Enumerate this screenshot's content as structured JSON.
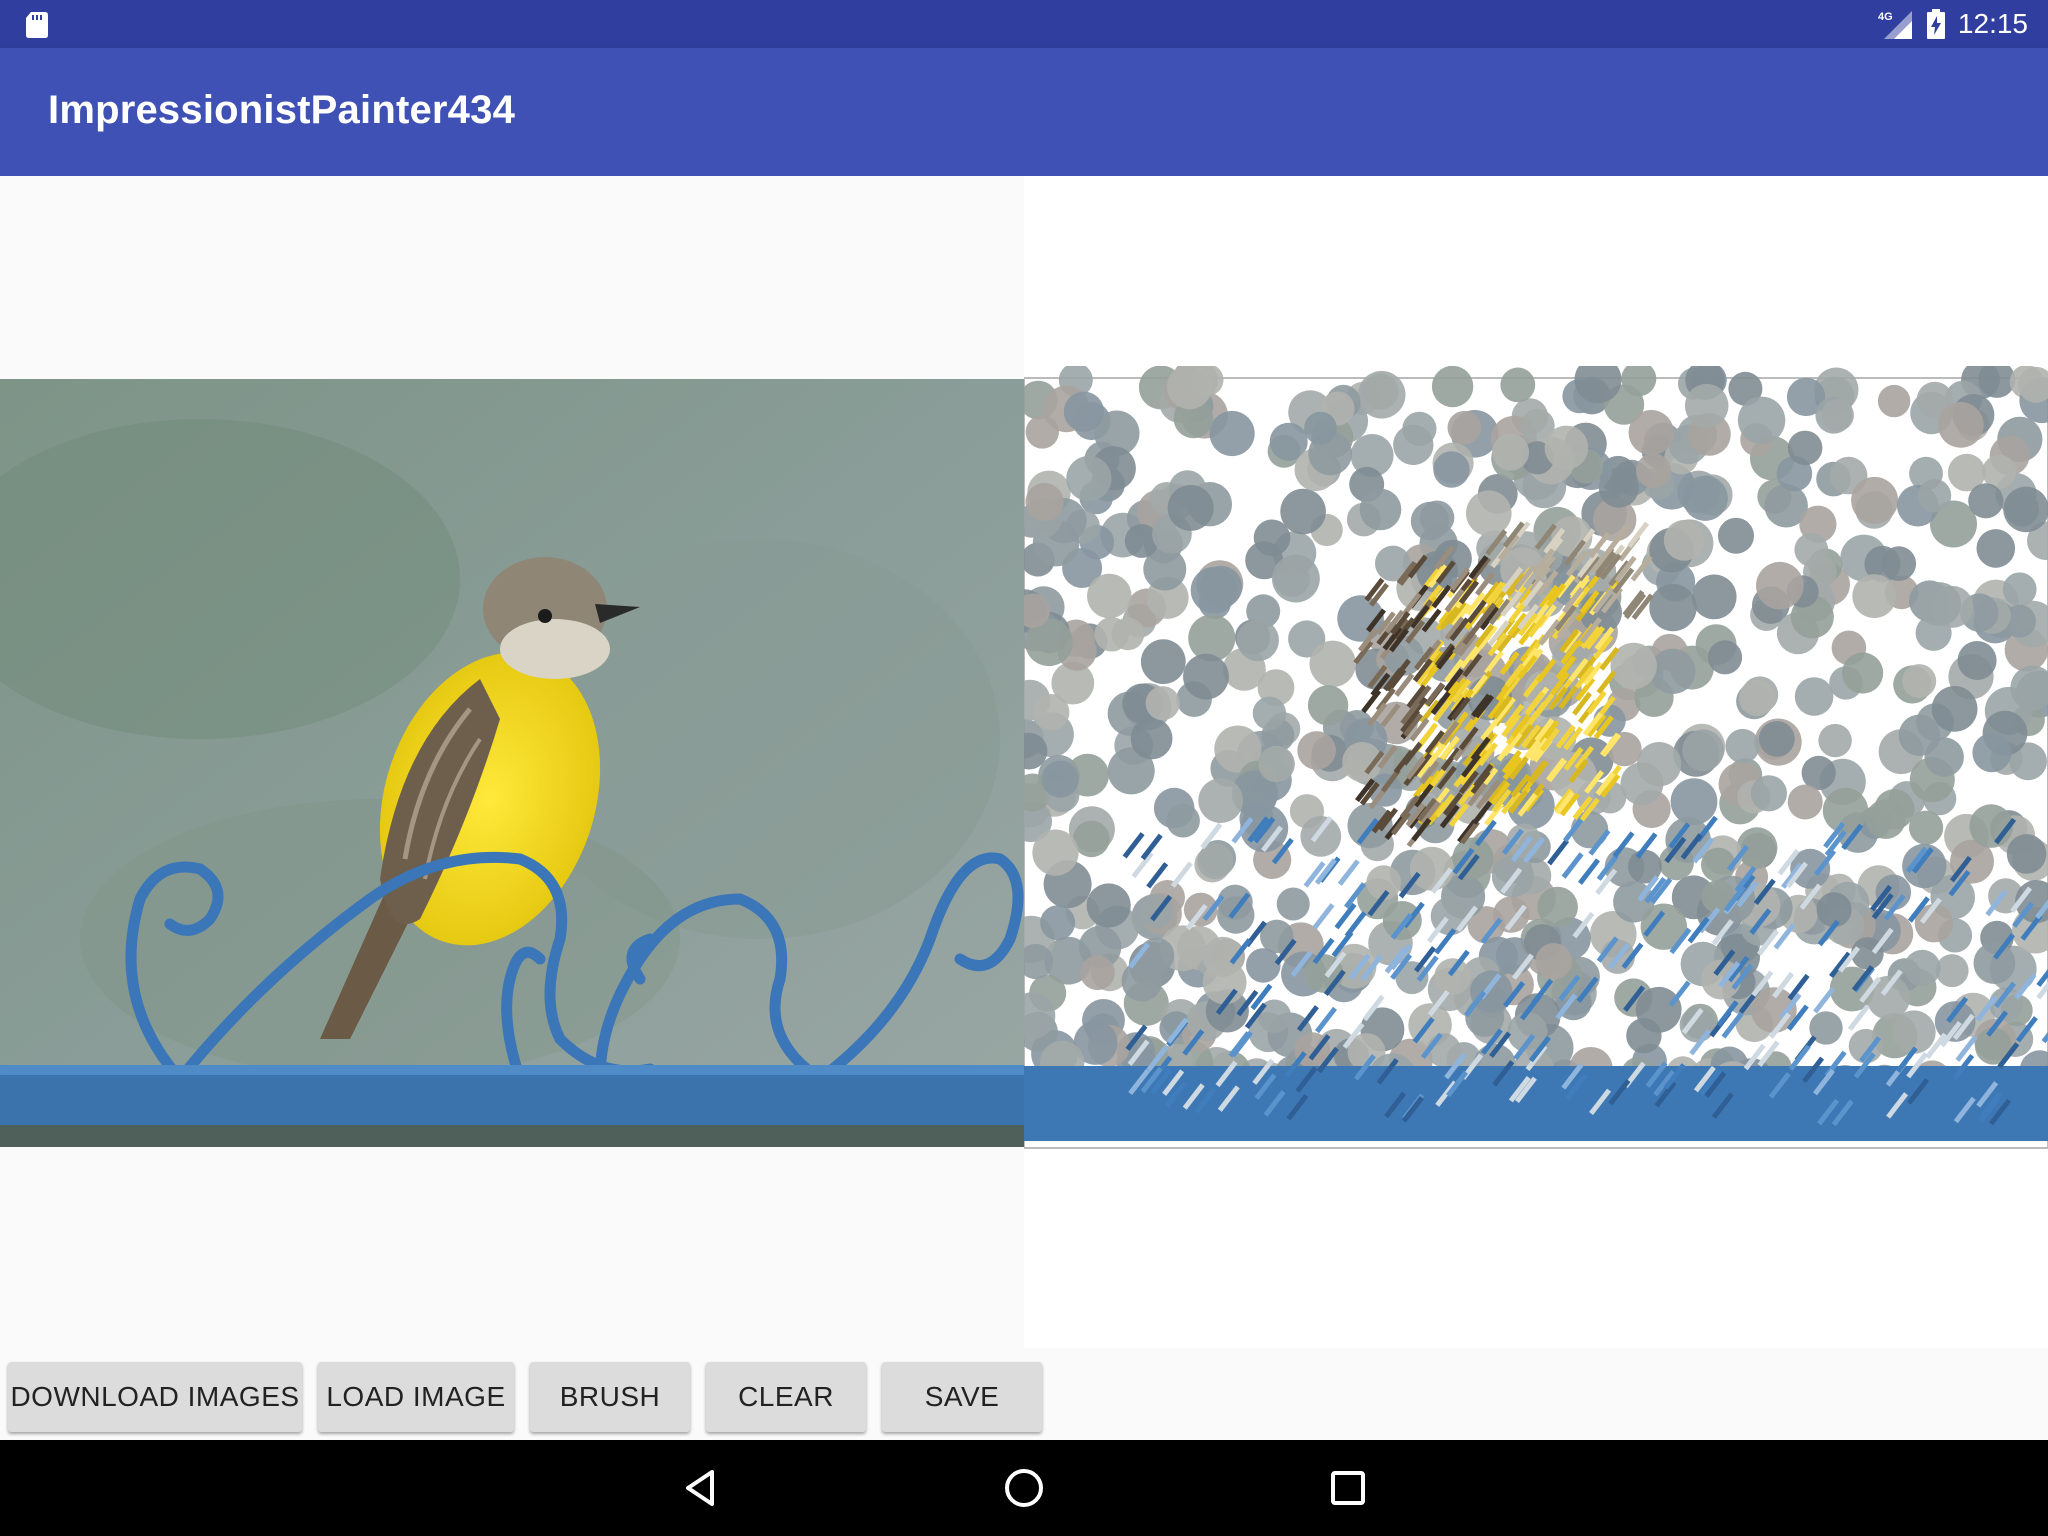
{
  "status_bar": {
    "time": "12:15",
    "network": "4G",
    "icons": [
      "sd-card-icon",
      "signal-icon",
      "battery-charging-icon"
    ]
  },
  "app_bar": {
    "title": "ImpressionistPainter434"
  },
  "left_pane": {
    "image": "original-bird-photo"
  },
  "right_pane": {
    "image": "impressionist-painting-canvas"
  },
  "buttons": {
    "download": "DOWNLOAD IMAGES",
    "load": "LOAD IMAGE",
    "brush": "BRUSH",
    "clear": "CLEAR",
    "save": "SAVE"
  },
  "nav_bar": {
    "icons": [
      "back-icon",
      "home-icon",
      "recents-icon"
    ]
  },
  "colors": {
    "status_bar": "#303f9f",
    "app_bar": "#3f51b5",
    "button": "#dcdcdc",
    "nav_bar": "#000000"
  }
}
